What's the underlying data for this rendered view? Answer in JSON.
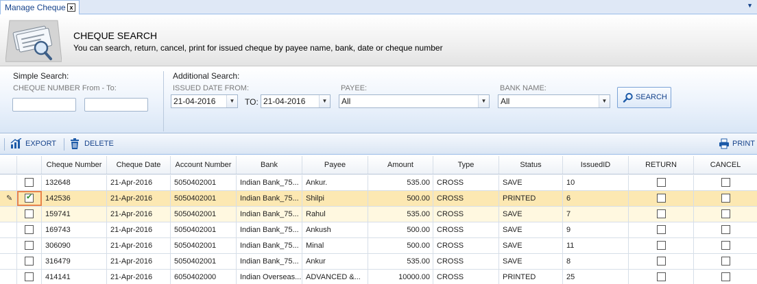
{
  "tab": {
    "label": "Manage Cheque",
    "close": "x",
    "menu": "▼"
  },
  "header": {
    "title": "CHEQUE SEARCH",
    "subtitle": "You can search, return, cancel, print for issued cheque by payee name, bank, date or cheque number"
  },
  "simple_search": {
    "heading": "Simple Search:",
    "cheque_number_label": "CHEQUE NUMBER From - To:",
    "from_value": "",
    "to_value": ""
  },
  "additional_search": {
    "heading": "Additional Search:",
    "issued_date_label": "ISSUED DATE FROM:",
    "date_from": "21-04-2016",
    "to_label": "TO:",
    "date_to": "21-04-2016",
    "payee_label": "PAYEE:",
    "payee_value": "All",
    "bank_label": "BANK NAME:",
    "bank_value": "All",
    "search_button": "SEARCH"
  },
  "toolbar": {
    "export": "EXPORT",
    "delete": "DELETE",
    "print": "PRINT"
  },
  "grid": {
    "columns": [
      "Cheque Number",
      "Cheque Date",
      "Account Number",
      "Bank",
      "Payee",
      "Amount",
      "Type",
      "Status",
      "IssuedID",
      "RETURN",
      "CANCEL"
    ],
    "rows": [
      {
        "selected": false,
        "editing": false,
        "cheque_number": "132648",
        "cheque_date": "21-Apr-2016",
        "account_number": "5050402001",
        "bank": "Indian Bank_75...",
        "payee": "Ankur.",
        "amount": "535.00",
        "type": "CROSS",
        "status": "SAVE",
        "issued_id": "10",
        "return": false,
        "cancel": false
      },
      {
        "selected": true,
        "editing": true,
        "cheque_number": "142536",
        "cheque_date": "21-Apr-2016",
        "account_number": "5050402001",
        "bank": "Indian Bank_75...",
        "payee": "Shilpi",
        "amount": "500.00",
        "type": "CROSS",
        "status": "PRINTED",
        "issued_id": "6",
        "return": false,
        "cancel": false
      },
      {
        "selected": false,
        "editing": false,
        "cheque_number": "159741",
        "cheque_date": "21-Apr-2016",
        "account_number": "5050402001",
        "bank": "Indian Bank_75...",
        "payee": "Rahul",
        "amount": "535.00",
        "type": "CROSS",
        "status": "SAVE",
        "issued_id": "7",
        "return": false,
        "cancel": false
      },
      {
        "selected": false,
        "editing": false,
        "cheque_number": "169743",
        "cheque_date": "21-Apr-2016",
        "account_number": "5050402001",
        "bank": "Indian Bank_75...",
        "payee": "Ankush",
        "amount": "500.00",
        "type": "CROSS",
        "status": "SAVE",
        "issued_id": "9",
        "return": false,
        "cancel": false
      },
      {
        "selected": false,
        "editing": false,
        "cheque_number": "306090",
        "cheque_date": "21-Apr-2016",
        "account_number": "5050402001",
        "bank": "Indian Bank_75...",
        "payee": "Minal",
        "amount": "500.00",
        "type": "CROSS",
        "status": "SAVE",
        "issued_id": "11",
        "return": false,
        "cancel": false
      },
      {
        "selected": false,
        "editing": false,
        "cheque_number": "316479",
        "cheque_date": "21-Apr-2016",
        "account_number": "5050402001",
        "bank": "Indian Bank_75...",
        "payee": "Ankur",
        "amount": "535.00",
        "type": "CROSS",
        "status": "SAVE",
        "issued_id": "8",
        "return": false,
        "cancel": false
      },
      {
        "selected": false,
        "editing": false,
        "cheque_number": "414141",
        "cheque_date": "21-Apr-2016",
        "account_number": "6050402000",
        "bank": "Indian Overseas...",
        "payee": "ADVANCED &...",
        "amount": "10000.00",
        "type": "CROSS",
        "status": "PRINTED",
        "issued_id": "25",
        "return": false,
        "cancel": false
      }
    ]
  },
  "colors": {
    "accent": "#15428b",
    "selected_row": "#fce8b2",
    "selected_border": "#e8834a"
  }
}
